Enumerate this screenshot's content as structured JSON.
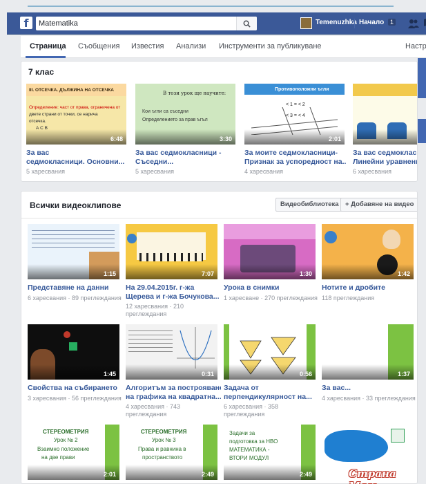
{
  "topbar": {
    "search_value": "Matematika",
    "user_name": "Temenuzhka",
    "home_label": "Начало",
    "home_count": "1"
  },
  "nav": {
    "tabs": [
      "Страница",
      "Съобщения",
      "Известия",
      "Анализи",
      "Инструменти за публикуване",
      "Настрой"
    ]
  },
  "playlist": {
    "title": "7 клас",
    "videos": [
      {
        "title1": "За вас",
        "title2": "седмокласници. Основни...",
        "meta": "5 харесвания",
        "duration": "6:48",
        "thumb_heading": "III. ОТСЕЧКА. ДЪЛЖИНА НА ОТСЕЧКА",
        "thumb_lines": [
          "Определение: част от права, ограничена от",
          "двете страни от точки, се нарича",
          "отсечка.",
          "А       С       В"
        ]
      },
      {
        "title1": "За вас седмокласници -",
        "title2": "Съседни...",
        "meta": "5 харесвания",
        "duration": "3:30",
        "thumb_heading": "В този урок ще научите:",
        "thumb_lines": [
          "Кои ъгли са съседни",
          "Определението за прав ъгъл"
        ]
      },
      {
        "title1": "За моите седмокласници-",
        "title2": "Признак за успоредност на...",
        "meta": "4 харесвания",
        "duration": "2:01",
        "thumb_heading": "Противоположни ъгли",
        "thumb_lines": [
          "< 1 = < 2",
          "< 3 = < 4"
        ]
      },
      {
        "title1": "За вас седмокласни",
        "title2": "Линейни уравнения",
        "meta": "6 харесвания",
        "duration": "",
        "thumb_heading": "",
        "thumb_lines": []
      }
    ]
  },
  "all_videos": {
    "title": "Всички видеоклипове",
    "library_button": "Видеобиблиотека",
    "add_button": "+ Добавяне на видео",
    "rows": [
      [
        {
          "title1": "Представяне на данни",
          "title2": "",
          "meta1": "6 харесвания · 89 преглеждания",
          "meta2": "",
          "duration": "1:15"
        },
        {
          "title1": "На 29.04.2015г. г-жа",
          "title2": "Щерева и г-жа Бочукова...",
          "meta1": "12 харесвания · 210",
          "meta2": "преглеждания",
          "duration": "7:07"
        },
        {
          "title1": "Урока в снимки",
          "title2": "",
          "meta1": "1 харесване · 270 преглеждания",
          "meta2": "",
          "duration": "1:30"
        },
        {
          "title1": "Нотите и дробите",
          "title2": "",
          "meta1": "118 преглеждания",
          "meta2": "",
          "duration": "1:42"
        }
      ],
      [
        {
          "title1": "Свойства на събирането",
          "title2": "",
          "meta1": "3 харесвания · 56 преглеждания",
          "meta2": "",
          "duration": "1:45"
        },
        {
          "title1": "Алгоритъм за построяване",
          "title2": "на графика на квадратна...",
          "meta1": "4 харесвания · 743",
          "meta2": "преглеждания",
          "duration": "0:31"
        },
        {
          "title1": "Задача от",
          "title2": "перпендикулярност на...",
          "meta1": "6 харесвания · 358",
          "meta2": "преглеждания",
          "duration": "0:56"
        },
        {
          "title1": "За вас...",
          "title2": "",
          "meta1": "4 харесвания · 33 преглеждания",
          "meta2": "",
          "duration": "1:37"
        }
      ],
      [
        {
          "title1": "",
          "title2": "",
          "meta1": "",
          "meta2": "",
          "duration": "2:01",
          "thumb_lines": [
            "СТЕРЕОМЕТРИЯ",
            "Урок № 2",
            "Взаимно положение",
            "на две прави"
          ]
        },
        {
          "title1": "",
          "title2": "",
          "meta1": "",
          "meta2": "",
          "duration": "2:49",
          "thumb_lines": [
            "СТЕРЕОМЕТРИЯ",
            "Урок № 3",
            "Права и равнина в",
            "пространството"
          ]
        },
        {
          "title1": "",
          "title2": "",
          "meta1": "",
          "meta2": "",
          "duration": "2:49",
          "thumb_lines": [
            "Задачи за",
            "подготовка за НВО",
            "МАТЕМАТИКА -",
            "ВТОРИ МОДУЛ"
          ]
        },
        {
          "title1": "",
          "title2": "",
          "meta1": "",
          "meta2": "",
          "duration": ""
        }
      ]
    ]
  },
  "watermark": "Страна Мам",
  "colors": {
    "brand": "#3b5998",
    "link": "#365899",
    "meta": "#90949c",
    "background": "#e9ebee"
  }
}
